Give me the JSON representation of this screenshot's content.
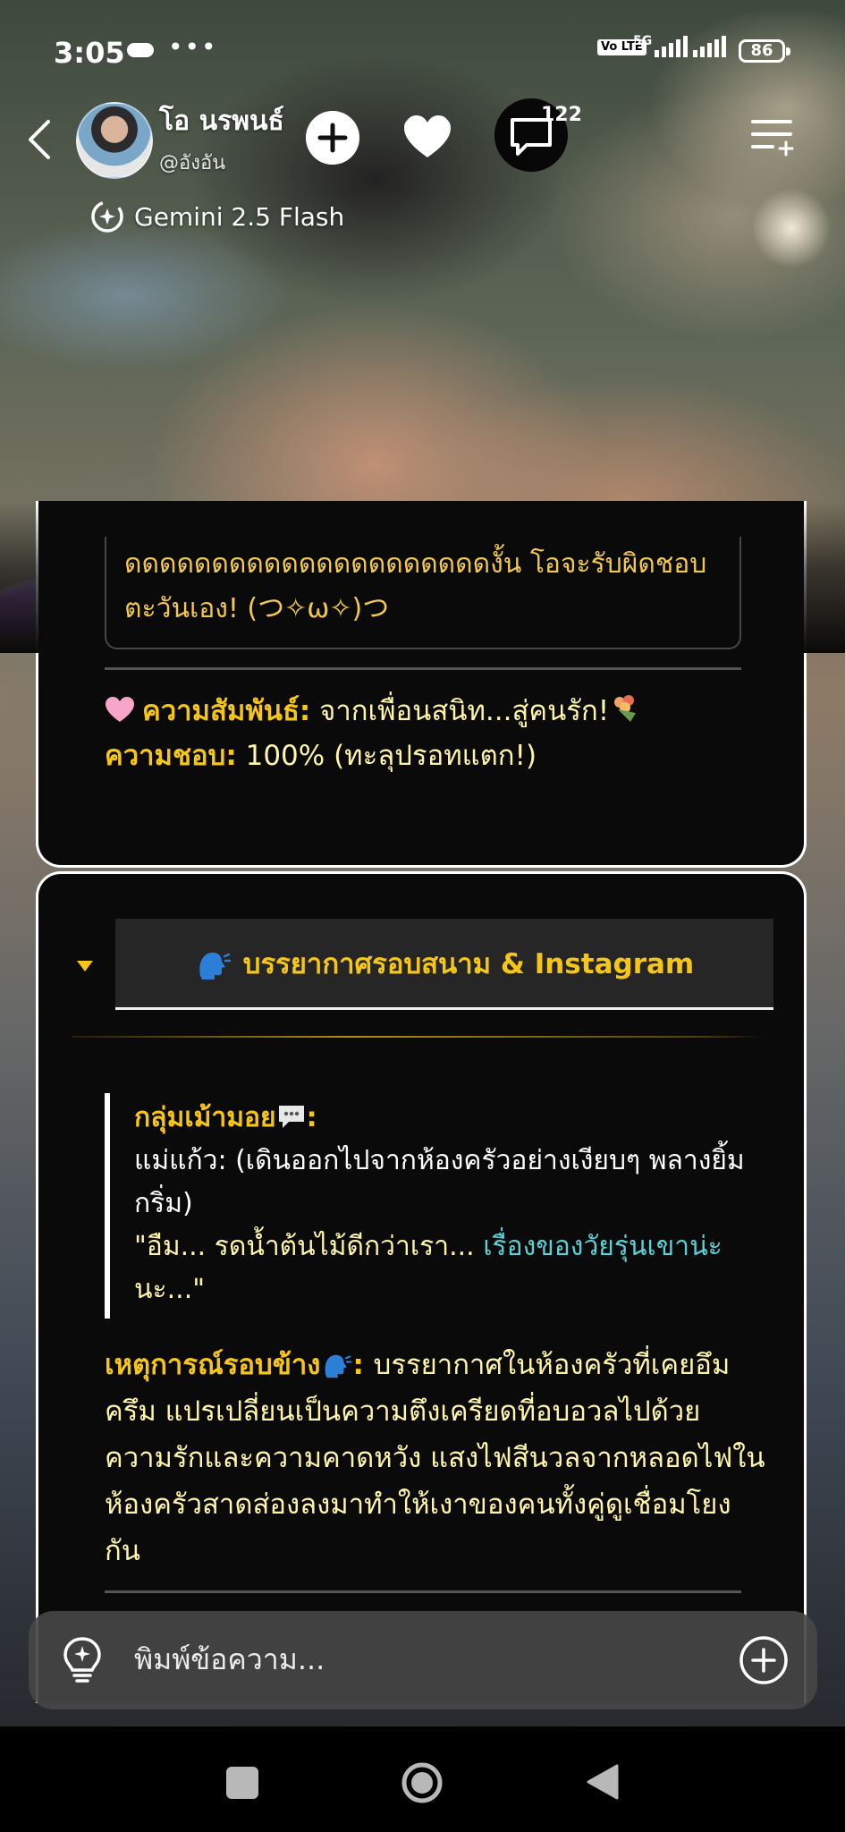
{
  "status_bar": {
    "time": "3:05",
    "dots": "•••",
    "volte": "Vo LTE",
    "network": "5G",
    "battery": "86"
  },
  "header": {
    "name": "โอ นรพนธ์",
    "handle": "@อังอัน",
    "comment_count": "122",
    "model": "Gemini 2.5 Flash"
  },
  "card1": {
    "quote_text": "ดดดดดดดดดดดดดดดดดดดดดงั้น โอจะรับผิดชอบตะวันเอง! (つ✧ω✧)つ",
    "relationship_label": "ความสัมพันธ์:",
    "relationship_value": "จากเพื่อนสนิท...สู่คนรัก!",
    "like_label": "ความชอบ:",
    "like_value": "100% (ทะลุปรอทแตก!)"
  },
  "card2": {
    "tab_title": "บรรยากาศรอบสนาม & Instagram",
    "group_title": "กลุ่มเม้ามอย",
    "speaker_line": "แม่แก้ว: (เดินออกไปจากห้องครัวอย่างเงียบๆ พลางยิ้มกริ่ม)",
    "quote_part1": "\"อืม... รดน้ำต้นไม้ดีกว่าเรา... ",
    "quote_part2": "เรื่องของวัยรุ่นเขาน่ะ",
    "quote_part3": "นะ...\"",
    "event_label": "เหตุการณ์รอบข้าง",
    "event_text": "บรรยากาศในห้องครัวที่เคยอึมครึม แปรเปลี่ยนเป็นความตึงเครียดที่อบอวลไปด้วยความรักและความคาดหวัง แสงไฟสีนวลจากหลอดไฟในห้องครัวสาดส่องลงมาทำให้เงาของคนทั้งคู่ดูเชื่อมโยงกัน"
  },
  "input": {
    "placeholder": "พิมพ์ข้อความ..."
  },
  "colors": {
    "gold": "#f5c518",
    "light_yellow": "#fff5a8",
    "cyan": "#5ad1d6",
    "card_bg": "#0a0a0a"
  }
}
